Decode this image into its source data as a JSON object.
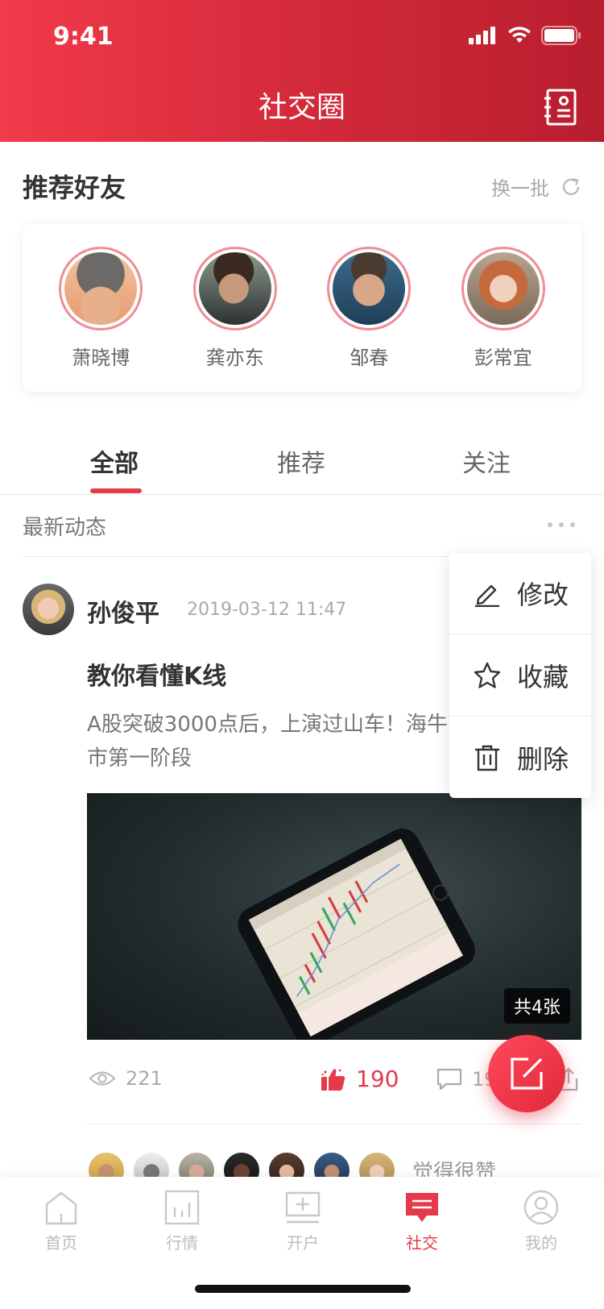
{
  "status_bar": {
    "time": "9:41"
  },
  "header": {
    "title": "社交圈"
  },
  "recommend": {
    "title": "推荐好友",
    "refresh_label": "换一批",
    "friends": [
      {
        "name": "萧晓博"
      },
      {
        "name": "龚亦东"
      },
      {
        "name": "邹春"
      },
      {
        "name": "彭常宜"
      }
    ]
  },
  "tabs": [
    {
      "label": "全部"
    },
    {
      "label": "推荐"
    },
    {
      "label": "关注"
    }
  ],
  "feed": {
    "label": "最新动态",
    "post": {
      "author": "孙俊平",
      "time": "2019-03-12 11:47",
      "title": "教你看懂K线",
      "body": "A股突破3000点后，上演过山车！海牛市第一阶段",
      "image_count": "共4张",
      "views": "221",
      "likes": "190",
      "comments": "19",
      "likers_text": "觉得很赞"
    }
  },
  "menu": [
    {
      "label": "修改",
      "icon": "edit-icon"
    },
    {
      "label": "收藏",
      "icon": "star-icon"
    },
    {
      "label": "删除",
      "icon": "trash-icon"
    }
  ],
  "tabbar": [
    {
      "label": "首页"
    },
    {
      "label": "行情"
    },
    {
      "label": "开户"
    },
    {
      "label": "社交"
    },
    {
      "label": "我的"
    }
  ],
  "colors": {
    "brand": "#e53a4a",
    "header_start": "#f23a4a",
    "header_end": "#b81e2e"
  }
}
